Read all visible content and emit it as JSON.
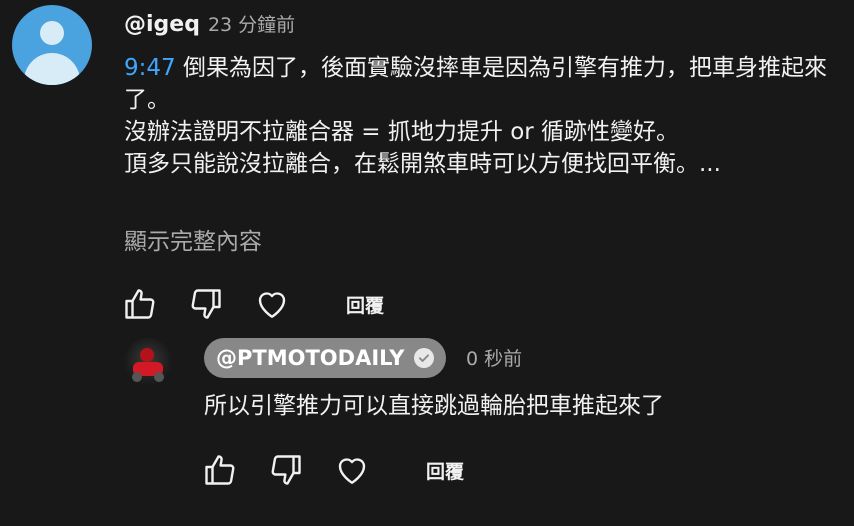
{
  "comment": {
    "handle": "@igeq",
    "time": "23 分鐘前",
    "timestamp_link": "9:47",
    "text_line1_rest": " 倒果為因了，後面實驗沒摔車是因為引擎有推力，把車身推起來了。",
    "paragraph2": "沒辦法證明不拉離合器 = 抓地力提升 or  循跡性變好。",
    "paragraph3": "頂多只能說沒拉離合，在鬆開煞車時可以方便找回平衡。...",
    "show_more": "顯示完整內容",
    "reply_label": "回覆"
  },
  "reply": {
    "handle": "@PTMOTODAILY",
    "time": "0 秒前",
    "text": "所以引擎推力可以直接跳過輪胎把車推起來了",
    "reply_label": "回覆"
  },
  "colors": {
    "background": "#181818",
    "text": "#f1f1f1",
    "secondary_text": "#aaaaaa",
    "link": "#3ea6ff",
    "owner_badge": "#888888"
  },
  "icons": {
    "like": "thumbs-up-icon",
    "dislike": "thumbs-down-icon",
    "heart": "heart-icon",
    "verified": "checkmark-circle-icon"
  }
}
